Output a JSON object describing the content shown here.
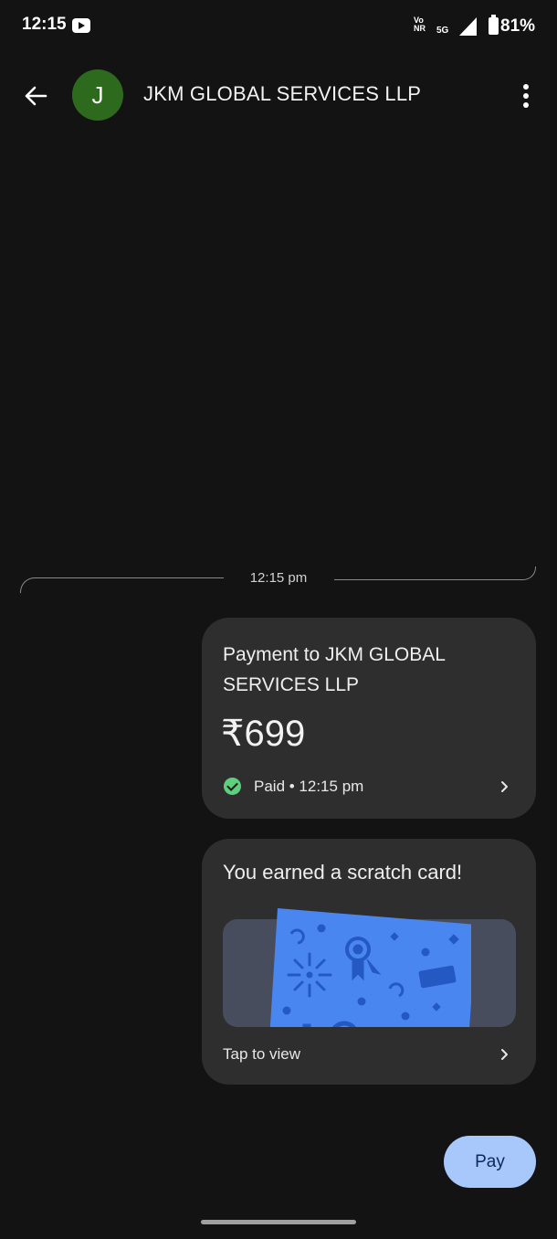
{
  "status_bar": {
    "time": "12:15",
    "volte_line1": "Vo",
    "volte_line2": "NR",
    "network": "5G",
    "battery": "81%"
  },
  "header": {
    "avatar_letter": "J",
    "contact_name": "JKM GLOBAL SERVICES LLP"
  },
  "thread": {
    "divider_time": "12:15 pm"
  },
  "payment_card": {
    "title": "Payment to JKM GLOBAL SERVICES LLP",
    "amount": "₹699",
    "status": "Paid • 12:15 pm",
    "status_color": "#5dcf7d"
  },
  "scratch_card": {
    "title": "You earned a scratch card!",
    "action": "Tap to view",
    "card_color": "#4a86f0"
  },
  "pay_button": {
    "label": "Pay",
    "color": "#a8c7fa"
  },
  "icons": [
    "back-arrow-icon",
    "more-vert-icon",
    "check-circle-icon",
    "chevron-right-icon",
    "youtube-icon",
    "signal-icon",
    "battery-icon"
  ]
}
